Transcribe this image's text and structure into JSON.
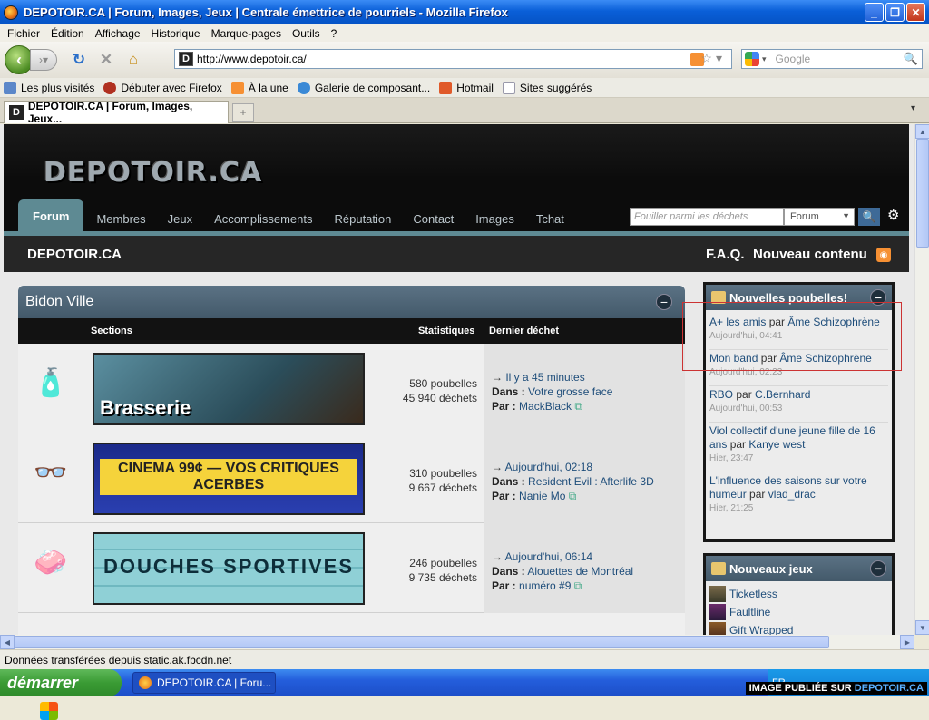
{
  "window": {
    "title": "DEPOTOIR.CA | Forum, Images, Jeux | Centrale émettrice de pourriels - Mozilla Firefox"
  },
  "menu": [
    "Fichier",
    "Édition",
    "Affichage",
    "Historique",
    "Marque-pages",
    "Outils",
    "?"
  ],
  "nav": {
    "url": "http://www.depotoir.ca/",
    "search_placeholder": "Google"
  },
  "bookmarks": [
    "Les plus visités",
    "Débuter avec Firefox",
    "À la une",
    "Galerie de composant...",
    "Hotmail",
    "Sites suggérés"
  ],
  "tab": {
    "label": "DEPOTOIR.CA | Forum, Images, Jeux..."
  },
  "site": {
    "logo": "DEPOTOIR.CA",
    "nav": [
      "Forum",
      "Membres",
      "Jeux",
      "Accomplissements",
      "Réputation",
      "Contact",
      "Images",
      "Tchat"
    ],
    "search_placeholder": "Fouiller parmi les déchets",
    "search_scope": "Forum",
    "brand": "DEPOTOIR.CA",
    "faq": "F.A.Q.",
    "new_content": "Nouveau contenu"
  },
  "forum": {
    "title": "Bidon Ville",
    "headers": {
      "sections": "Sections",
      "stats": "Statistiques",
      "last": "Dernier déchet"
    },
    "rows": [
      {
        "banner": "Brasserie",
        "posts": "580 poubelles",
        "replies": "45 940 déchets",
        "time": "Il y a 45 minutes",
        "in_label": "Dans :",
        "topic": "Votre grosse face",
        "by_label": "Par :",
        "author": "MackBlack"
      },
      {
        "banner": "CINEMA 99¢ — VOS CRITIQUES ACERBES",
        "posts": "310 poubelles",
        "replies": "9 667 déchets",
        "time": "Aujourd'hui, 02:18",
        "in_label": "Dans :",
        "topic": "Resident Evil : Afterlife 3D",
        "by_label": "Par :",
        "author": "Nanie Mo"
      },
      {
        "banner": "DOUCHES SPORTIVES",
        "posts": "246 poubelles",
        "replies": "9 735 déchets",
        "time": "Aujourd'hui, 06:14",
        "in_label": "Dans :",
        "topic": "Alouettes de Montréal",
        "by_label": "Par :",
        "author": "numéro #9"
      }
    ]
  },
  "sidebar": {
    "new_title": "Nouvelles poubelles!",
    "by": "par",
    "items": [
      {
        "topic": "A+ les amis",
        "author": "Âme Schizophrène",
        "when": "Aujourd'hui, 04:41"
      },
      {
        "topic": "Mon band",
        "author": "Âme Schizophrène",
        "when": "Aujourd'hui, 02:23"
      },
      {
        "topic": "RBO",
        "author": "C.Bernhard",
        "when": "Aujourd'hui, 00:53"
      },
      {
        "topic": "Viol collectif d'une jeune fille de 16 ans",
        "author": "Kanye west",
        "when": "Hier, 23:47"
      },
      {
        "topic": "L'influence des saisons sur votre humeur",
        "author": "vlad_drac",
        "when": "Hier, 21:25"
      }
    ],
    "games_title": "Nouveaux jeux",
    "games": [
      "Ticketless",
      "Faultline",
      "Gift Wrapped"
    ]
  },
  "status": {
    "text": "Données transférées depuis static.ak.fbcdn.net"
  },
  "taskbar": {
    "start": "démarrer",
    "task": "DEPOTOIR.CA | Foru...",
    "lang": "FR",
    "watermark_prefix": "IMAGE PUBLIÉE SUR",
    "watermark_site": "DEPOTOIR.CA"
  }
}
